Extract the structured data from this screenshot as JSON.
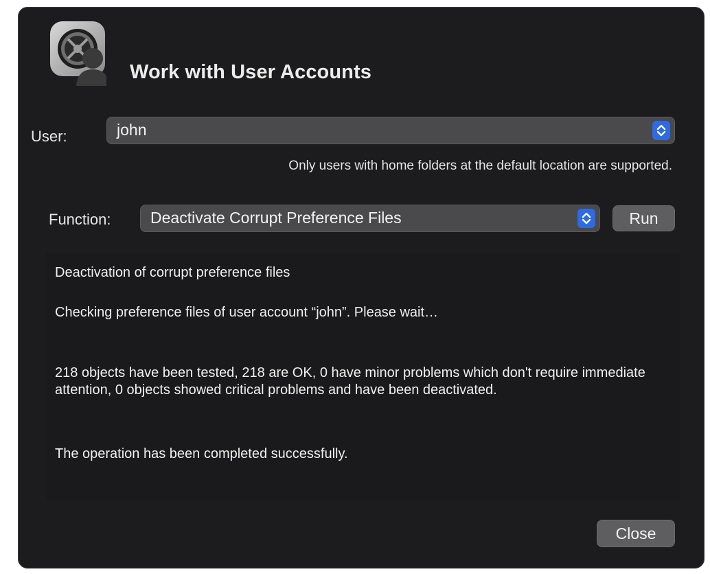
{
  "window": {
    "title": "Work with User Accounts"
  },
  "user": {
    "label": "User:",
    "selected": "john",
    "note": "Only users with home folders at the default location are supported."
  },
  "function": {
    "label": "Function:",
    "selected": "Deactivate Corrupt Preference Files",
    "run_label": "Run"
  },
  "log": {
    "lines": [
      "Deactivation of corrupt preference files",
      "Checking preference files of user account “john”. Please wait…",
      "218 objects have been tested, 218 are OK, 0 have minor problems which don't require immediate attention, 0 objects showed critical problems and have been deactivated.",
      "The operation has been completed successfully."
    ]
  },
  "footer": {
    "close_label": "Close"
  },
  "icons": {
    "app": "user-accounts-app-icon",
    "stepper": "chevron-up-down-icon"
  },
  "colors": {
    "background": "#1c1c1e",
    "control": "#4a4a4c",
    "accent": "#2d6ae3",
    "text": "#f0f0f0"
  }
}
